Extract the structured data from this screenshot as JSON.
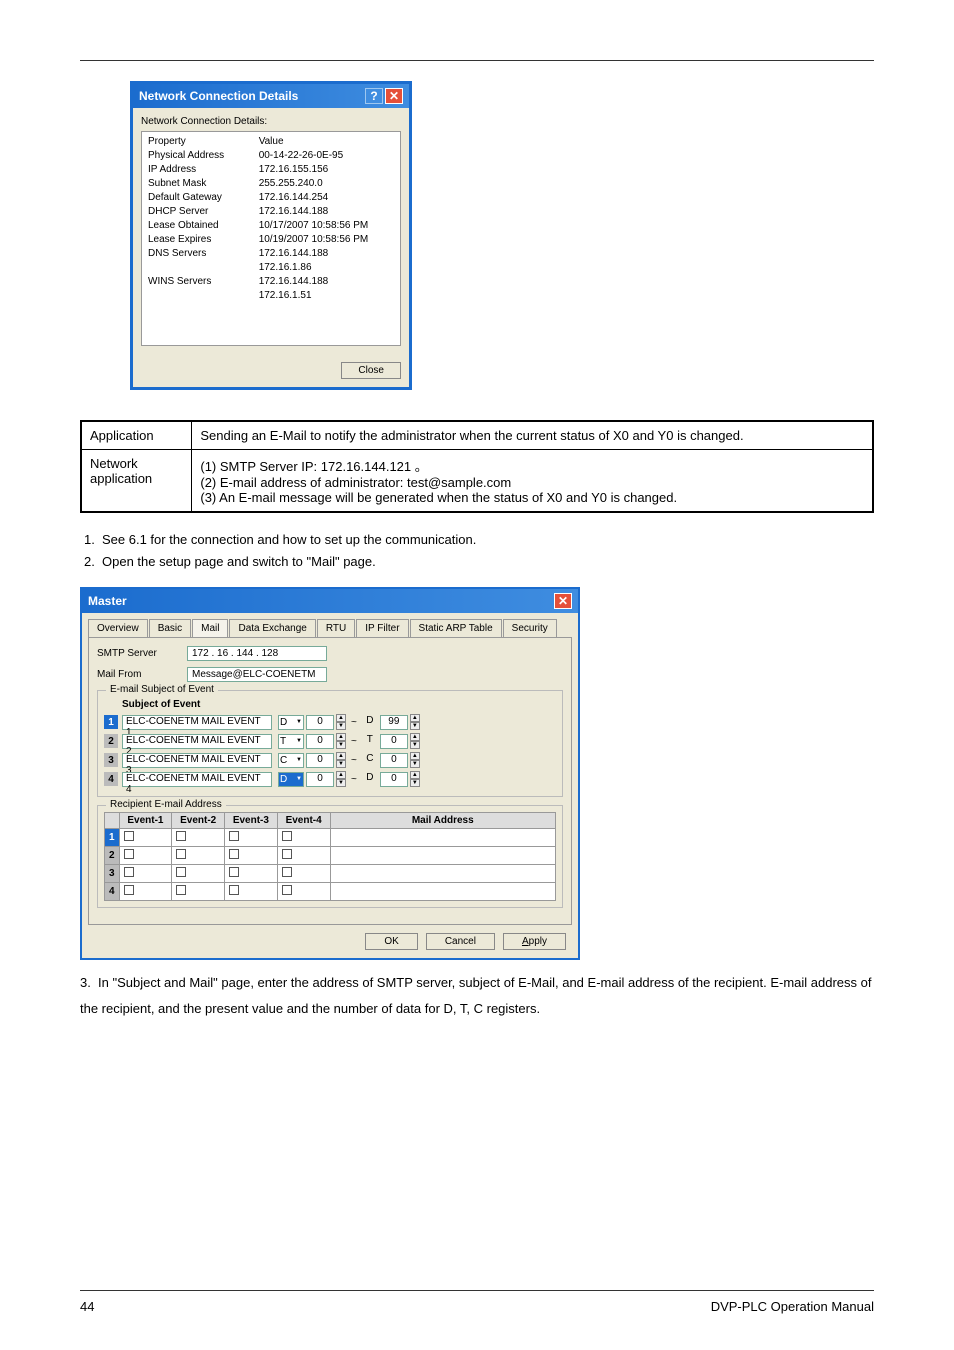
{
  "ncdetails": {
    "title": "Network Connection Details",
    "subtitle": "Network Connection Details:",
    "cols": {
      "prop": "Property",
      "val": "Value"
    },
    "rows": [
      {
        "prop": "Physical Address",
        "val": "00-14-22-26-0E-95"
      },
      {
        "prop": "IP Address",
        "val": "172.16.155.156"
      },
      {
        "prop": "Subnet Mask",
        "val": "255.255.240.0"
      },
      {
        "prop": "Default Gateway",
        "val": "172.16.144.254"
      },
      {
        "prop": "DHCP Server",
        "val": "172.16.144.188"
      },
      {
        "prop": "Lease Obtained",
        "val": "10/17/2007 10:58:56 PM"
      },
      {
        "prop": "Lease Expires",
        "val": "10/19/2007 10:58:56 PM"
      },
      {
        "prop": "DNS Servers",
        "val": "172.16.144.188"
      },
      {
        "prop": "",
        "val": "172.16.1.86"
      },
      {
        "prop": "WINS Servers",
        "val": "172.16.144.188"
      },
      {
        "prop": "",
        "val": "172.16.1.51"
      }
    ],
    "close": "Close"
  },
  "apptable": {
    "r1_label": "Application",
    "r1_text": "Sending an E-Mail to notify the administrator when the current status of X0 and Y0 is changed.",
    "r2_label": "Network application",
    "r2_lines": [
      "(1)  SMTP Server IP: 172.16.144.121 。",
      "(2)  E-mail address of administrator: test@sample.com",
      "(3)  An E-mail message will be generated when the status of X0 and Y0 is changed."
    ]
  },
  "steps12": [
    "See 6.1 for the connection and how to set up the communication.",
    "Open the setup page and switch to \"Mail\" page."
  ],
  "master": {
    "title": "Master",
    "tabs": [
      "Overview",
      "Basic",
      "Mail",
      "Data Exchange",
      "RTU",
      "IP Filter",
      "Static ARP Table",
      "Security"
    ],
    "active_tab": "Mail",
    "form": {
      "smtp_label": "SMTP Server",
      "smtp_value": "172  .  16   . 144  .  128",
      "from_label": "Mail From",
      "from_value": "Message@ELC-COENETM"
    },
    "subject_group": "E-mail Subject of Event",
    "subject_header": "Subject of Event",
    "subjects": [
      "ELC-COENETM MAIL EVENT 1",
      "ELC-COENETM MAIL EVENT 2",
      "ELC-COENETM MAIL EVENT 3",
      "ELC-COENETM MAIL EVENT 4"
    ],
    "reg_rows": [
      {
        "sel": "D",
        "v1": "0",
        "t": "D",
        "v2": "99"
      },
      {
        "sel": "T",
        "v1": "0",
        "t": "T",
        "v2": "0"
      },
      {
        "sel": "C",
        "v1": "0",
        "t": "C",
        "v2": "0"
      },
      {
        "sel": "D",
        "v1": "0",
        "t": "D",
        "v2": "0",
        "hi": true
      }
    ],
    "recip_group": "Recipient E-mail Address",
    "recip_cols": [
      "Event-1",
      "Event-2",
      "Event-3",
      "Event-4",
      "Mail Address"
    ],
    "buttons": {
      "ok": "OK",
      "cancel": "Cancel",
      "apply": "Apply"
    }
  },
  "step3": "In \"Subject and Mail\" page, enter the address of SMTP server, subject of E-Mail, and E-mail address of the recipient. E-mail address of the recipient, and the present value and the number of data for D, T, C registers.",
  "footer": {
    "page": "44",
    "doc": "DVP-PLC Operation Manual"
  }
}
